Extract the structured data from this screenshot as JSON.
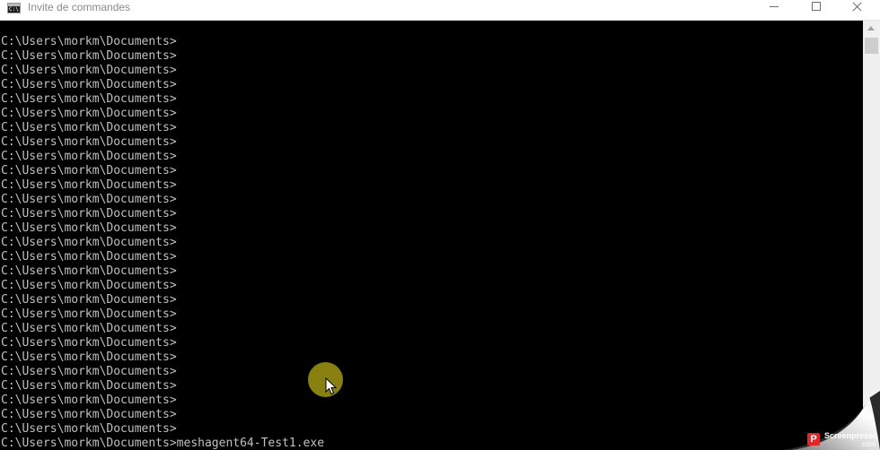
{
  "window": {
    "title": "Invite de commandes",
    "icon_glyph": "C:\\",
    "controls": [
      "minimize-icon",
      "maximize-icon",
      "close-icon"
    ]
  },
  "console": {
    "lines": [
      "C:\\Users\\morkm\\Documents>",
      "C:\\Users\\morkm\\Documents>",
      "C:\\Users\\morkm\\Documents>",
      "C:\\Users\\morkm\\Documents>",
      "C:\\Users\\morkm\\Documents>",
      "C:\\Users\\morkm\\Documents>",
      "C:\\Users\\morkm\\Documents>",
      "C:\\Users\\morkm\\Documents>",
      "C:\\Users\\morkm\\Documents>",
      "C:\\Users\\morkm\\Documents>",
      "C:\\Users\\morkm\\Documents>",
      "C:\\Users\\morkm\\Documents>",
      "C:\\Users\\morkm\\Documents>",
      "C:\\Users\\morkm\\Documents>",
      "C:\\Users\\morkm\\Documents>",
      "C:\\Users\\morkm\\Documents>",
      "C:\\Users\\morkm\\Documents>",
      "C:\\Users\\morkm\\Documents>",
      "C:\\Users\\morkm\\Documents>",
      "C:\\Users\\morkm\\Documents>",
      "C:\\Users\\morkm\\Documents>",
      "C:\\Users\\morkm\\Documents>",
      "C:\\Users\\morkm\\Documents>",
      "C:\\Users\\morkm\\Documents>",
      "C:\\Users\\morkm\\Documents>",
      "C:\\Users\\morkm\\Documents>",
      "C:\\Users\\morkm\\Documents>",
      "C:\\Users\\morkm\\Documents>",
      "C:\\Users\\morkm\\Documents>meshagent64-Test1.exe"
    ],
    "text_color": "#c0c0c0",
    "background": "#000000"
  },
  "watermark": {
    "logo_letter": "P",
    "brand": "Screenpresso",
    "domain": ".com"
  },
  "cursor": {
    "halo_color": "#aaa014"
  }
}
